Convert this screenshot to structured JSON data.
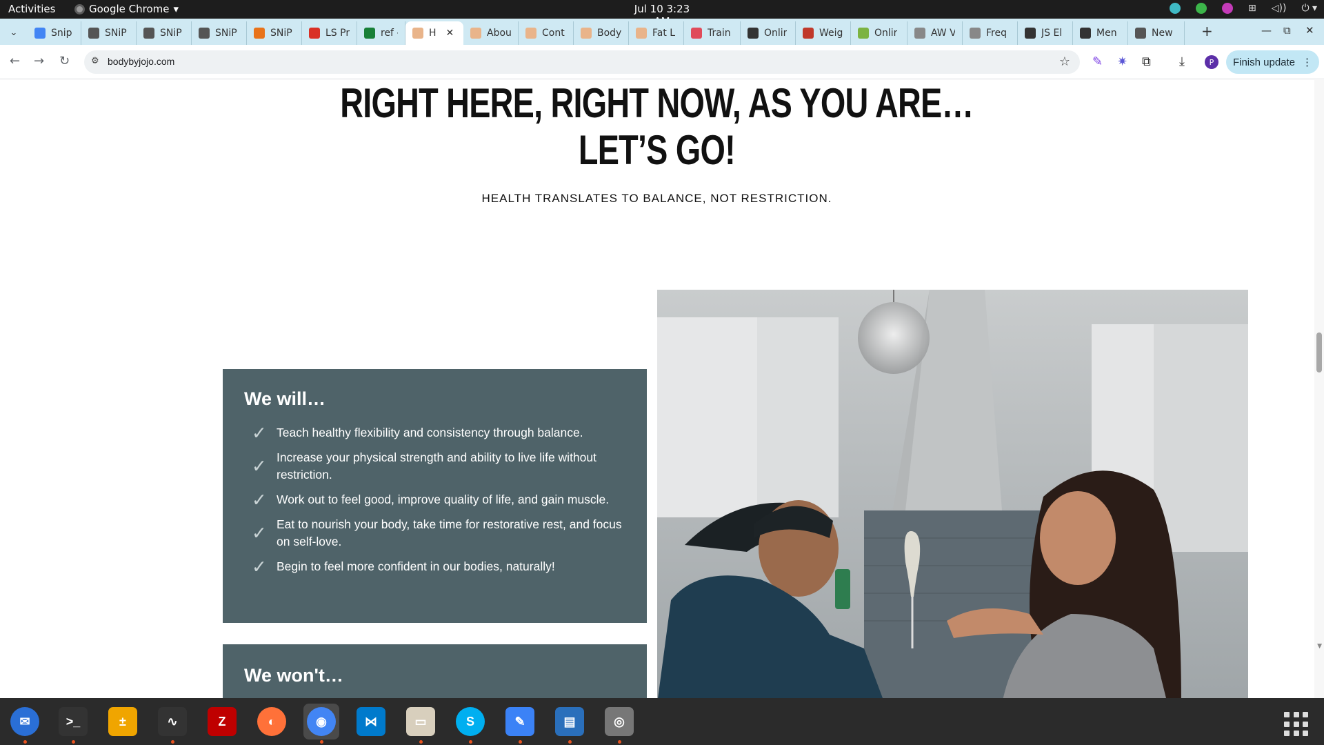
{
  "topbar": {
    "activities": "Activities",
    "app_name": "Google Chrome",
    "clock": "Jul 10  3:23 AM"
  },
  "tabs": [
    {
      "title": "Snip",
      "icon": "docs-icon",
      "color": "#4285f4"
    },
    {
      "title": "SNiP",
      "icon": "snip-logo-icon",
      "color": "#555555"
    },
    {
      "title": "SNiP",
      "icon": "snip-logo-icon",
      "color": "#555555"
    },
    {
      "title": "SNiP",
      "icon": "snip-logo-icon",
      "color": "#555555"
    },
    {
      "title": "SNiP",
      "icon": "emoji-icon",
      "color": "#e8731a"
    },
    {
      "title": "LS Pr",
      "icon": "emoji-icon",
      "color": "#d93025"
    },
    {
      "title": "ref -",
      "icon": "sheets-icon",
      "color": "#188038"
    },
    {
      "title": "H",
      "icon": "peach-icon",
      "color": "#e9b48a",
      "active": true
    },
    {
      "title": "Abou",
      "icon": "peach-icon",
      "color": "#e9b48a"
    },
    {
      "title": "Cont",
      "icon": "peach-icon",
      "color": "#e9b48a"
    },
    {
      "title": "Body",
      "icon": "peach-icon",
      "color": "#e9b48a"
    },
    {
      "title": "Fat L",
      "icon": "peach-icon",
      "color": "#e9b48a"
    },
    {
      "title": "Train",
      "icon": "heart-icon",
      "color": "#e04b5a"
    },
    {
      "title": "Onlir",
      "icon": "person-icon",
      "color": "#333333"
    },
    {
      "title": "Weig",
      "icon": "person-icon",
      "color": "#c0392b"
    },
    {
      "title": "Onlir",
      "icon": "image-icon",
      "color": "#7cb342"
    },
    {
      "title": "AW V",
      "icon": "image-icon",
      "color": "#888888"
    },
    {
      "title": "Freq",
      "icon": "image-icon",
      "color": "#888888"
    },
    {
      "title": "JS El",
      "icon": "shield-icon",
      "color": "#333333"
    },
    {
      "title": "Men",
      "icon": "shield-icon",
      "color": "#333333"
    },
    {
      "title": "New",
      "icon": "globe-icon",
      "color": "#555555"
    }
  ],
  "toolbar": {
    "url": "bodybyjojo.com",
    "finish_update": "Finish update",
    "profile_initial": "P"
  },
  "page": {
    "heading_line1": "RIGHT HERE, RIGHT NOW, AS YOU ARE…",
    "heading_line2": "LET’S GO!",
    "subtitle": "HEALTH TRANSLATES TO BALANCE, NOT RESTRICTION.",
    "we_will": {
      "title": "We will…",
      "items": [
        "Teach healthy flexibility and consistency through balance.",
        "Increase your physical strength and ability to live life without restriction.",
        "Work out to feel good, improve quality of life, and gain muscle.",
        "Eat to nourish your body, take time for restorative rest, and focus on self-love.",
        "Begin to feel more confident in our bodies, naturally!"
      ]
    },
    "we_wont": {
      "title": "We won't…"
    },
    "colors": {
      "panel_bg": "#4f6369",
      "check": "#c9d3d5",
      "heading": "#111111"
    }
  },
  "dock": [
    {
      "name": "thunderbird-icon",
      "color": "#2a6fd6"
    },
    {
      "name": "terminal-icon",
      "color": "#333333"
    },
    {
      "name": "calculator-icon",
      "color": "#f0a500"
    },
    {
      "name": "system-monitor-icon",
      "color": "#333333"
    },
    {
      "name": "filezilla-icon",
      "color": "#bf0000"
    },
    {
      "name": "firefox-icon",
      "color": "#ff7139"
    },
    {
      "name": "chrome-icon",
      "color": "#4285f4"
    },
    {
      "name": "vscode-icon",
      "color": "#007acc"
    },
    {
      "name": "files-icon",
      "color": "#d8cfbd"
    },
    {
      "name": "skype-icon",
      "color": "#00aff0"
    },
    {
      "name": "text-editor-icon",
      "color": "#3b82f6"
    },
    {
      "name": "libreoffice-writer-icon",
      "color": "#2a6fbb"
    },
    {
      "name": "disks-icon",
      "color": "#777777"
    }
  ]
}
